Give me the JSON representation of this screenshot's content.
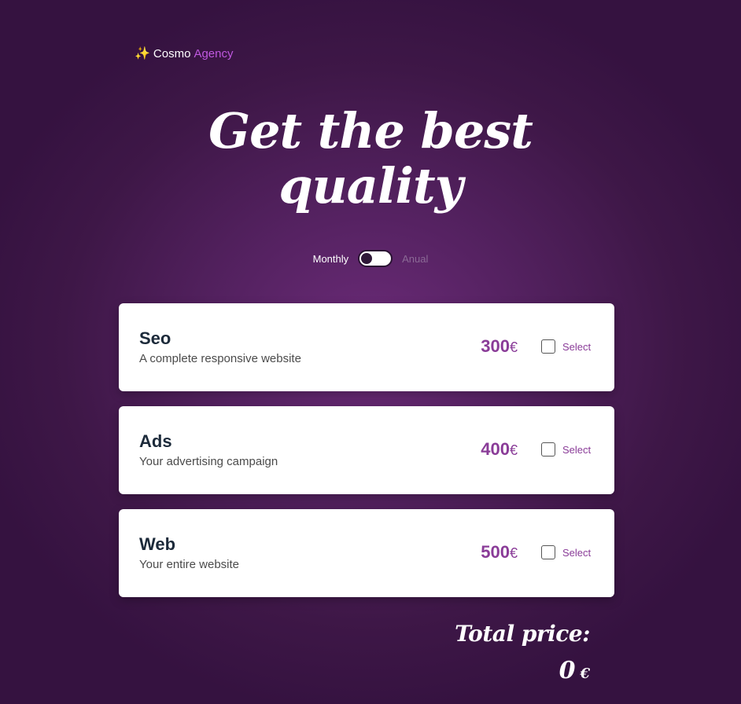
{
  "brand": {
    "icon": "sparkles-icon",
    "name_part1": "Cosmo",
    "name_part2": "Agency",
    "accent_color": "#c058e0"
  },
  "hero": {
    "title_line1": "Get the best",
    "title_line2": "quality"
  },
  "billing": {
    "monthly_label": "Monthly",
    "annual_label": "Anual",
    "selected": "Monthly"
  },
  "plans": [
    {
      "name": "Seo",
      "description": "A complete responsive website",
      "price": "300",
      "currency": "€",
      "select_label": "Select",
      "checked": false
    },
    {
      "name": "Ads",
      "description": "Your advertising campaign",
      "price": "400",
      "currency": "€",
      "select_label": "Select",
      "checked": false
    },
    {
      "name": "Web",
      "description": "Your entire website",
      "price": "500",
      "currency": "€",
      "select_label": "Select",
      "checked": false
    }
  ],
  "total": {
    "label": "Total price:",
    "value": "0",
    "currency": "€"
  },
  "colors": {
    "background": "#53215f",
    "price": "#8a3c98",
    "card": "#ffffff"
  }
}
